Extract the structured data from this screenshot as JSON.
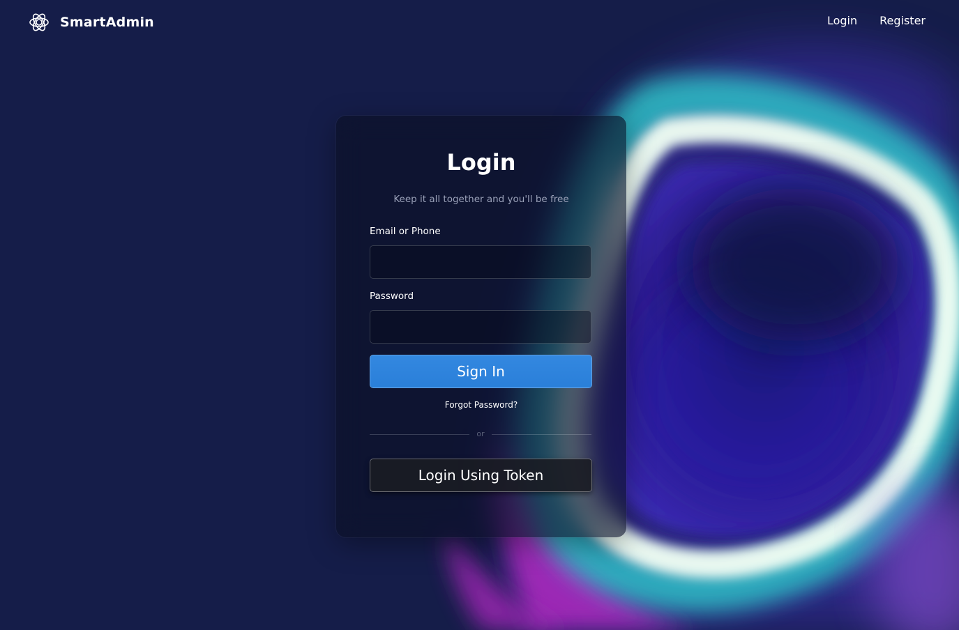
{
  "brand": {
    "name": "SmartAdmin",
    "logo_icon": "atom-icon"
  },
  "nav": {
    "login_label": "Login",
    "register_label": "Register"
  },
  "login_card": {
    "title": "Login",
    "subtitle": "Keep it all together and you'll be free",
    "email_label": "Email or Phone",
    "email_value": "",
    "password_label": "Password",
    "password_value": "",
    "signin_label": "Sign In",
    "forgot_label": "Forgot Password?",
    "divider_text": "or",
    "token_label": "Login Using Token"
  },
  "colors": {
    "background": "#151d49",
    "primary_button": "#2a7fd9",
    "card": "#0a0e24"
  }
}
